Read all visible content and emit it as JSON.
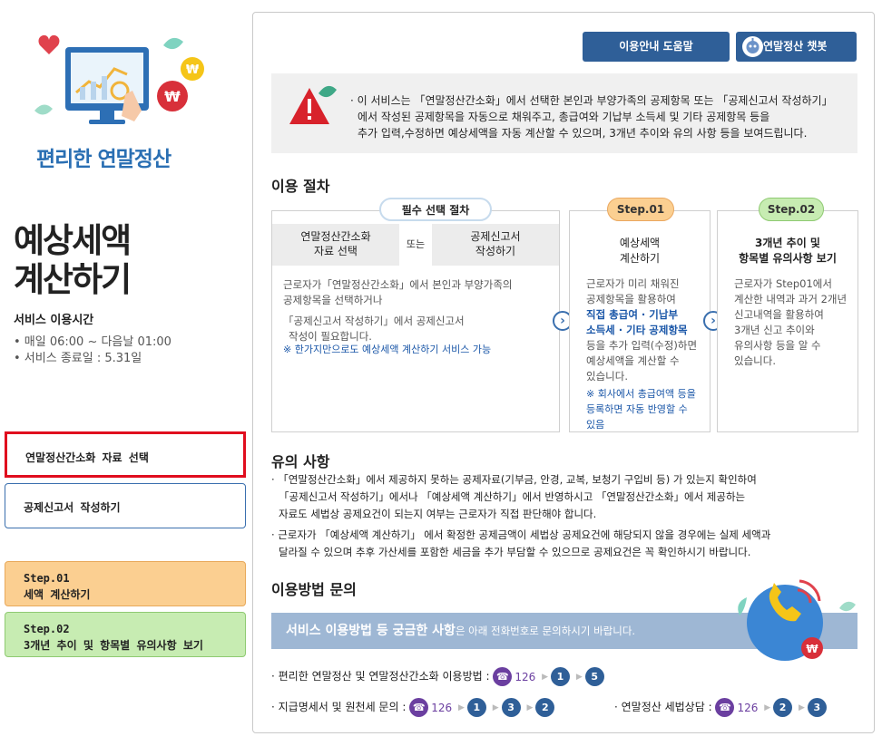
{
  "sidebar": {
    "brand_title": "편리한 연말정산",
    "page_title_line1": "예상세액",
    "page_title_line2": "계산하기",
    "service_hours_label": "서비스 이용시간",
    "service_hours": "• 매일 06:00 ~ 다음날 01:00",
    "service_end": "• 서비스 종료일 : 5.31일",
    "menu": {
      "simplified_data": "연말정산간소화 자료 선택",
      "deduction_form": "공제신고서 작성하기",
      "step1_label": "Step.01",
      "step1_title": "세액 계산하기",
      "step2_label": "Step.02",
      "step2_title": "3개년 추이 및 항목별 유의사항 보기"
    }
  },
  "header_buttons": {
    "help": "이용안내 도움말",
    "chatbot": "연말정산 챗봇"
  },
  "notice": {
    "line1": "· 이 서비스는 「연말정산간소화」에서 선택한 본인과 부양가족의 공제항목 또는 「공제신고서 작성하기」",
    "line2": "에서 작성된 공제항목을 자동으로 채워주고, 총급여와 기납부 소득세 및 기타 공제항목 등을",
    "line3": "추가 입력,수정하면 예상세액을 자동 계산할 수 있으며, 3개년 추이와 유의 사항 등을 보여드립니다."
  },
  "procedure": {
    "title": "이용 절차",
    "required": {
      "pill": "필수 선택 절차",
      "left_line1": "연말정산간소화",
      "left_line2": "자료 선택",
      "or": "또는",
      "right_line1": "공제신고서",
      "right_line2": "작성하기",
      "desc1": "근로자가「연말정산간소화」에서 본인과 부양가족의",
      "desc2": "공제항목을 선택하거나",
      "desc3": "「공제신고서 작성하기」에서 공제신고서",
      "desc4": "작성이 필요합니다.",
      "note": "※ 한가지만으로도 예상세액 계산하기 서비스 가능"
    },
    "step1": {
      "pill": "Step.01",
      "head1": "예상세액",
      "head2": "계산하기",
      "d1": "근로자가 미리 채워진",
      "d2": "공제항목을 활용하여",
      "d3": "직접 총급여 · 기납부",
      "d4": "소득세 · 기타 공제항목",
      "d5": "등을 추가 입력(수정)하면",
      "d6": "예상세액을 계산할 수",
      "d7": "있습니다.",
      "n1": "※ 회사에서 총급여액 등을",
      "n2": "등록하면 자동 반영할 수",
      "n3": "있음"
    },
    "step2": {
      "pill": "Step.02",
      "head1": "3개년 추이 및",
      "head2": "항목별 유의사항 보기",
      "d1": "근로자가 Step01에서",
      "d2": "계산한 내역과 과거 2개년",
      "d3": "신고내역을 활용하여",
      "d4": "3개년 신고 추이와",
      "d5": "유의사항 등을 알 수",
      "d6": "있습니다."
    }
  },
  "cautions": {
    "title": "유의 사항",
    "l1": "· 「연말정산간소화」에서 제공하지 못하는 공제자료(기부금, 안경, 교복, 보청기 구입비 등) 가 있는지 확인하여",
    "l2": "「공제신고서 작성하기」에서나 「예상세액 계산하기」에서 반영하시고 「연말정산간소화」에서 제공하는",
    "l3": "자료도 세법상 공제요건이 되는지 여부는 근로자가 직접 판단해야 합니다.",
    "l4": "· 근로자가 「예상세액 계산하기」 에서 확정한 공제금액이 세법상 공제요건에 해당되지 않을 경우에는 실제 세액과",
    "l5": "달라질 수 있으며 추후 가산세를 포함한 세금을 추가 부담할 수 있으므로 공제요건은 꼭 확인하시기 바랍니다."
  },
  "inquiry": {
    "title": "이용방법 문의",
    "banner_bold": "서비스 이용방법 등 궁금한 사항",
    "banner_rest": "은 아래 전화번호로 문의하시기 바랍니다.",
    "line1_label": "· 편리한 연말정산 및 연말정산간소화 이용방법 :",
    "line1_tel": "126",
    "line1_nums": [
      "1",
      "5"
    ],
    "line2_label": "· 지급명세서 및 원천세 문의 :",
    "line2_tel": "126",
    "line2_nums": [
      "1",
      "3",
      "2"
    ],
    "line3_label": "· 연말정산 세법상담 :",
    "line3_tel": "126",
    "line3_nums": [
      "2",
      "3"
    ]
  },
  "colors": {
    "accent": "#2f5f98",
    "selected_border": "#e00d1e",
    "step1": "#fbcf91",
    "step2": "#c7ecb2",
    "phone": "#6b3fa0"
  }
}
